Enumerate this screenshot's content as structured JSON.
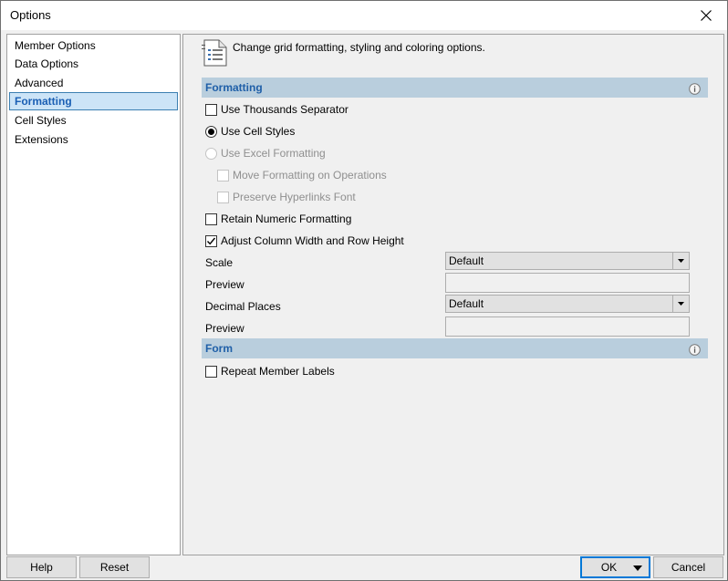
{
  "window": {
    "title": "Options"
  },
  "sidebar": {
    "items": [
      {
        "label": "Member Options",
        "selected": false
      },
      {
        "label": "Data Options",
        "selected": false
      },
      {
        "label": "Advanced",
        "selected": false
      },
      {
        "label": "Formatting",
        "selected": true
      },
      {
        "label": "Cell Styles",
        "selected": false
      },
      {
        "label": "Extensions",
        "selected": false
      }
    ]
  },
  "header": {
    "text": "Change grid formatting, styling and coloring options."
  },
  "formatting": {
    "title": "Formatting",
    "use_thousands_separator": {
      "label": "Use Thousands Separator",
      "checked": false
    },
    "use_cell_styles": {
      "label": "Use Cell Styles",
      "selected": true
    },
    "use_excel_formatting": {
      "label": "Use Excel Formatting",
      "selected": false,
      "enabled": false
    },
    "move_formatting": {
      "label": "Move Formatting on Operations",
      "checked": false,
      "enabled": false
    },
    "preserve_hyperlinks": {
      "label": "Preserve Hyperlinks Font",
      "checked": false,
      "enabled": false
    },
    "retain_numeric": {
      "label": "Retain Numeric Formatting",
      "checked": false
    },
    "adjust_column_width": {
      "label": "Adjust Column Width and Row Height",
      "checked": true
    },
    "scale": {
      "label": "Scale",
      "value": "Default"
    },
    "scale_preview": {
      "label": "Preview",
      "value": ""
    },
    "decimal_places": {
      "label": "Decimal Places",
      "value": "Default"
    },
    "decimal_preview": {
      "label": "Preview",
      "value": ""
    }
  },
  "form": {
    "title": "Form",
    "repeat_member_labels": {
      "label": "Repeat Member Labels",
      "checked": false
    }
  },
  "footer": {
    "help_label": "Help",
    "reset_label": "Reset",
    "ok_label": "OK",
    "cancel_label": "Cancel"
  },
  "colors": {
    "section_bar": "#b9cedd",
    "section_title": "#1f5fa8",
    "selection_border": "#3c7fb1",
    "default_button_border": "#0078d7"
  }
}
